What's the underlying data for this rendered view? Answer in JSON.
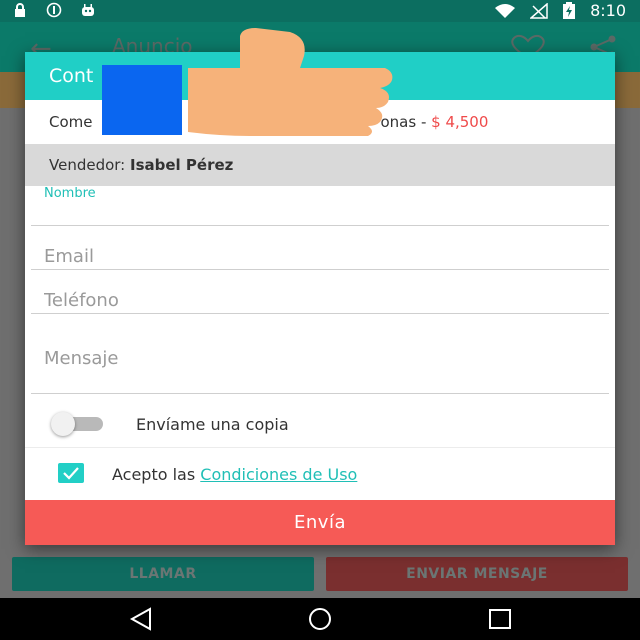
{
  "status_bar": {
    "time": "8:10",
    "icons": [
      "lock-icon",
      "info-circle-icon",
      "android-icon",
      "wifi-icon",
      "signal-icon",
      "battery-charging-icon"
    ]
  },
  "app_bar": {
    "title": "Anuncio",
    "icons": [
      "back-arrow-icon",
      "heart-icon",
      "share-icon"
    ]
  },
  "dialog": {
    "header_title": "Cont",
    "ad_line": {
      "prefix": "Come",
      "suffix": "onas - ",
      "price": "$ 4,500"
    },
    "seller": {
      "label": "Vendedor: ",
      "name": "Isabel Pérez"
    },
    "fields": {
      "name_label": "Nombre",
      "name_value": "",
      "email_placeholder": "Email",
      "phone_placeholder": "Teléfono",
      "message_placeholder": "Mensaje"
    },
    "copy_switch": {
      "label": "Envíame una copia",
      "on": false
    },
    "terms": {
      "prefix": "Acepto las ",
      "link": "Condiciones de Uso",
      "checked": true
    },
    "submit_label": "Envía"
  },
  "bottom_buttons": {
    "call_label": "LLAMAR",
    "message_label": "ENVIAR MENSAJE"
  },
  "nav_bar": {
    "icons": [
      "back-triangle-icon",
      "home-circle-icon",
      "recents-square-icon"
    ]
  },
  "colors": {
    "accent": "#20cfc6",
    "submit": "#f65a56",
    "price": "#ef4a4a",
    "status_bar": "#0c6e60"
  }
}
